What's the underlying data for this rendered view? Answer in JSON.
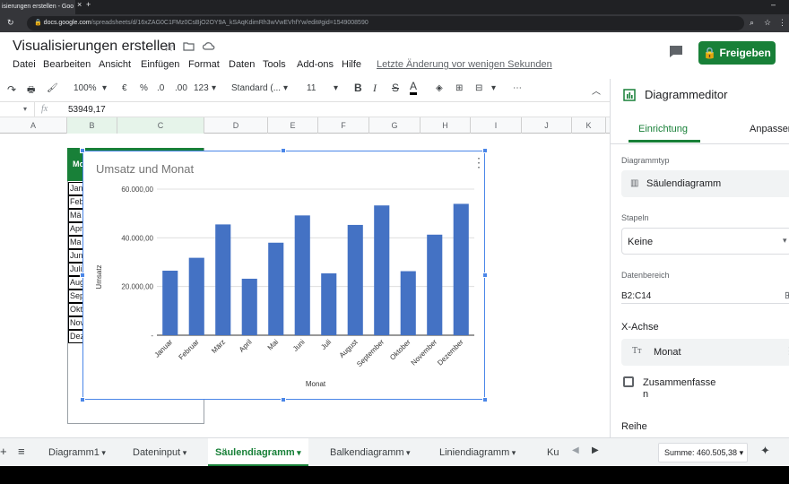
{
  "browser": {
    "tab_title": "isierungen erstellen - Goo",
    "url": "docs.google.com",
    "url_rest": "/spreadsheets/d/16xZAG0C1FMz0CsBjO2OY9A_kSAqKdimRh3wVwEVhfYw/edit#gid=1549008590"
  },
  "doc": {
    "title": "Visualisierungen erstellen",
    "menu": [
      "Datei",
      "Bearbeiten",
      "Ansicht",
      "Einfügen",
      "Format",
      "Daten",
      "Tools",
      "Add-ons",
      "Hilfe"
    ],
    "last_edit": "Letzte Änderung vor wenigen Sekunden",
    "share_label": "Freigeben"
  },
  "toolbar": {
    "zoom": "100%",
    "currency": "€",
    "percent": "%",
    "dec_less": ".0",
    "dec_more": ".00",
    "more_formats": "123",
    "font": "Standard (...",
    "font_size": "11",
    "bold": "B",
    "italic": "I",
    "strike": "S",
    "text_color": "A",
    "more": "⋯"
  },
  "formula": {
    "cell_ref": "",
    "fx": "fx",
    "value": "53949,17"
  },
  "columns": [
    "A",
    "B",
    "C",
    "D",
    "E",
    "F",
    "G",
    "H",
    "I",
    "J",
    "K"
  ],
  "rows_visible": [
    "Jan",
    "Feb",
    "Mä",
    "Apr",
    "Ma",
    "Jun",
    "Juli",
    "Aug",
    "Sep",
    "Okt",
    "Nov",
    "Dez"
  ],
  "green_header_text": "Mo",
  "chart_data": {
    "type": "bar",
    "title": "Umsatz und Monat",
    "xlabel": "Monat",
    "ylabel": "Umsatz",
    "categories": [
      "Januar",
      "Februar",
      "März",
      "April",
      "Mai",
      "Juni",
      "Juli",
      "August",
      "September",
      "Oktober",
      "November",
      "Dezember"
    ],
    "values": [
      26500,
      31800,
      45500,
      23200,
      38000,
      49200,
      25400,
      45300,
      53300,
      26300,
      41300,
      53949.17
    ],
    "ylim": [
      0,
      60000
    ],
    "yticks": [
      "-",
      "20.000,00",
      "40.000,00",
      "60.000,00"
    ],
    "color": "#4472c4",
    "grid": true
  },
  "panel": {
    "title": "Diagrammeditor",
    "tab_setup": "Einrichtung",
    "tab_customize": "Anpassen",
    "chart_type_label": "Diagrammtyp",
    "chart_type_value": "Säulendiagramm",
    "stack_label": "Stapeln",
    "stack_value": "Keine",
    "range_label": "Datenbereich",
    "range_value": "B2:C14",
    "xaxis_label": "X-Achse",
    "xaxis_value": "Monat",
    "aggregate_line1": "Zusammenfasse",
    "aggregate_line2": "n",
    "series_label": "Reihe",
    "accent": "#188038"
  },
  "sheets": {
    "tabs": [
      "Diagramm1",
      "Dateninput",
      "Säulendiagramm",
      "Balkendiagramm",
      "Liniendiagramm",
      "Ku"
    ],
    "active": 2,
    "sum": "Summe: 460.505,38"
  }
}
